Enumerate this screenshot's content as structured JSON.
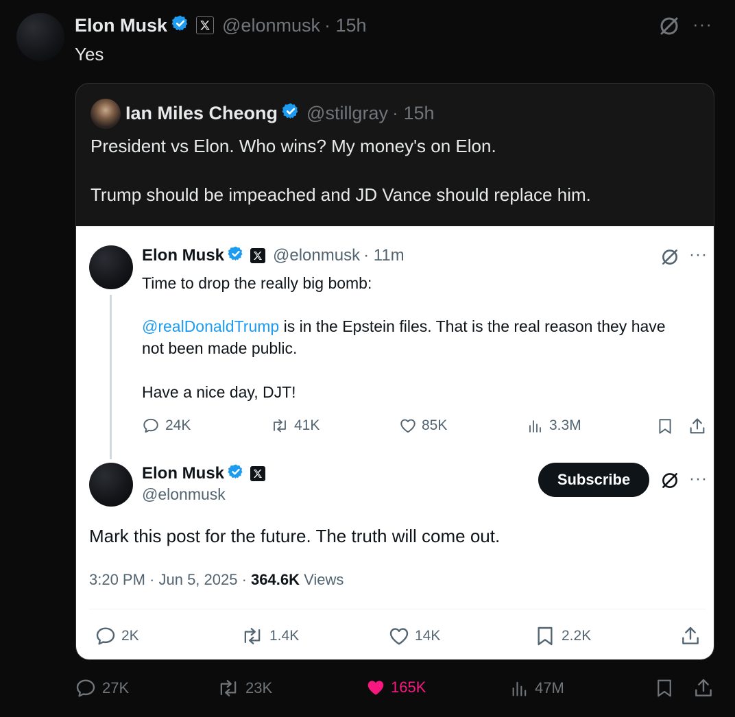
{
  "tweet": {
    "author_name": "Elon Musk",
    "handle": "@elonmusk",
    "time": "· 15h",
    "text": "Yes",
    "more": "···",
    "actions": {
      "replies": "27K",
      "reposts": "23K",
      "likes": "165K",
      "views": "47M"
    },
    "colors": {
      "background": "#0b0b0b",
      "verified": "#1d9bf0",
      "like": "#f91880",
      "muted": "#71767b"
    }
  },
  "quote": {
    "author_name": "Ian Miles Cheong",
    "handle": "@stillgray",
    "time": "· 15h",
    "line1": "President vs Elon. Who wins? My money's on Elon.",
    "line2": "Trump should be impeached and JD Vance should replace him."
  },
  "screenshot": {
    "post1": {
      "author_name": "Elon Musk",
      "handle": "@elonmusk",
      "time": "· 11m",
      "line1": "Time to drop the really big bomb:",
      "mention": "@realDonaldTrump",
      "line2a": " is in the Epstein files. That is the real reason they have",
      "line2b": "not been made public.",
      "line3": "Have a nice day, DJT!",
      "more": "···",
      "actions": {
        "replies": "24K",
        "reposts": "41K",
        "likes": "85K",
        "views": "3.3M"
      }
    },
    "post2": {
      "author_name": "Elon Musk",
      "handle": "@elonmusk",
      "subscribe_label": "Subscribe",
      "more": "···",
      "text": "Mark this post for the future. The truth will come out.",
      "meta_time": "3:20 PM · Jun 5, 2025 · ",
      "meta_views_count": "364.6K",
      "meta_views_label": " Views",
      "actions": {
        "replies": "2K",
        "reposts": "1.4K",
        "likes": "14K",
        "bookmarks": "2.2K"
      }
    }
  }
}
